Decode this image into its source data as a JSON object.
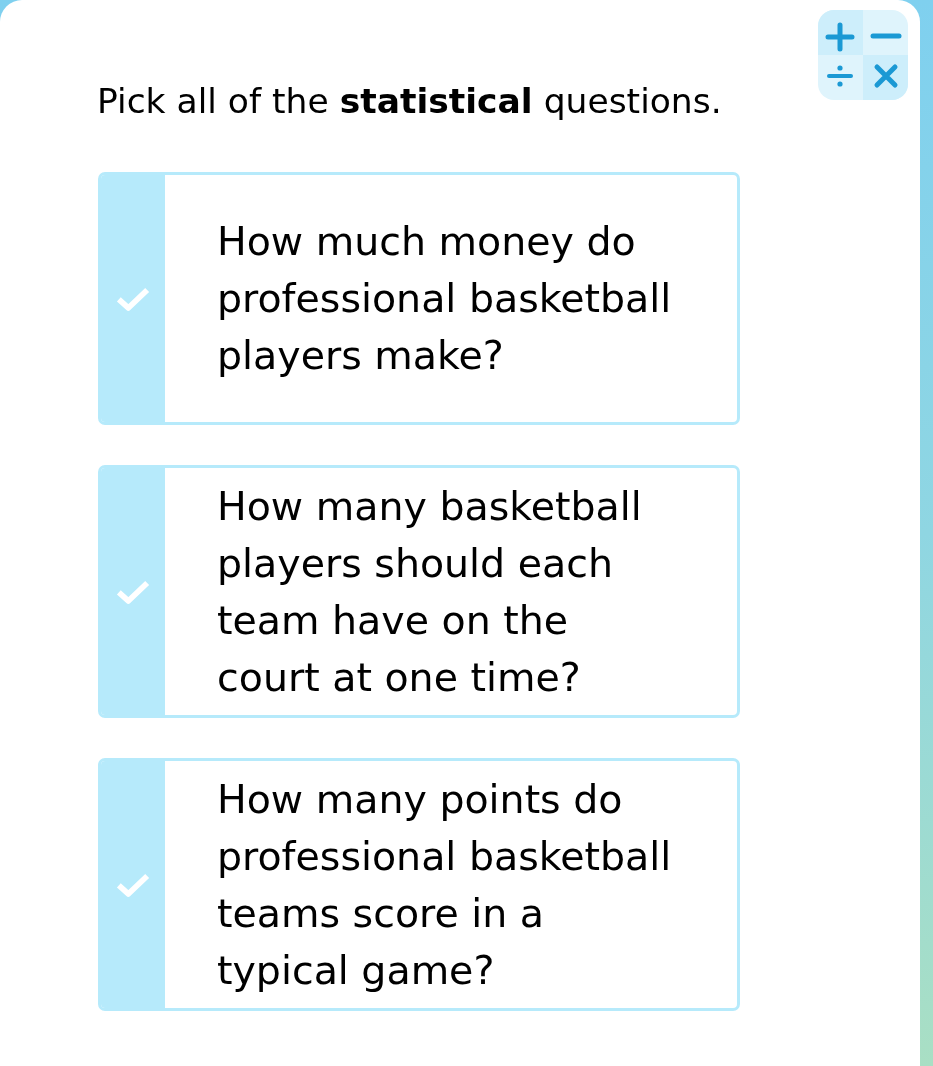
{
  "instruction": "Pick all of the **statistical** questions.",
  "choices": [
    {
      "text": "How much money do professional basketball players make?",
      "selected": false
    },
    {
      "text": "How many basketball players should each team have on the court at one time?",
      "selected": false
    },
    {
      "text": "How many points do professional basketball teams score in a typical game?",
      "selected": false
    }
  ]
}
